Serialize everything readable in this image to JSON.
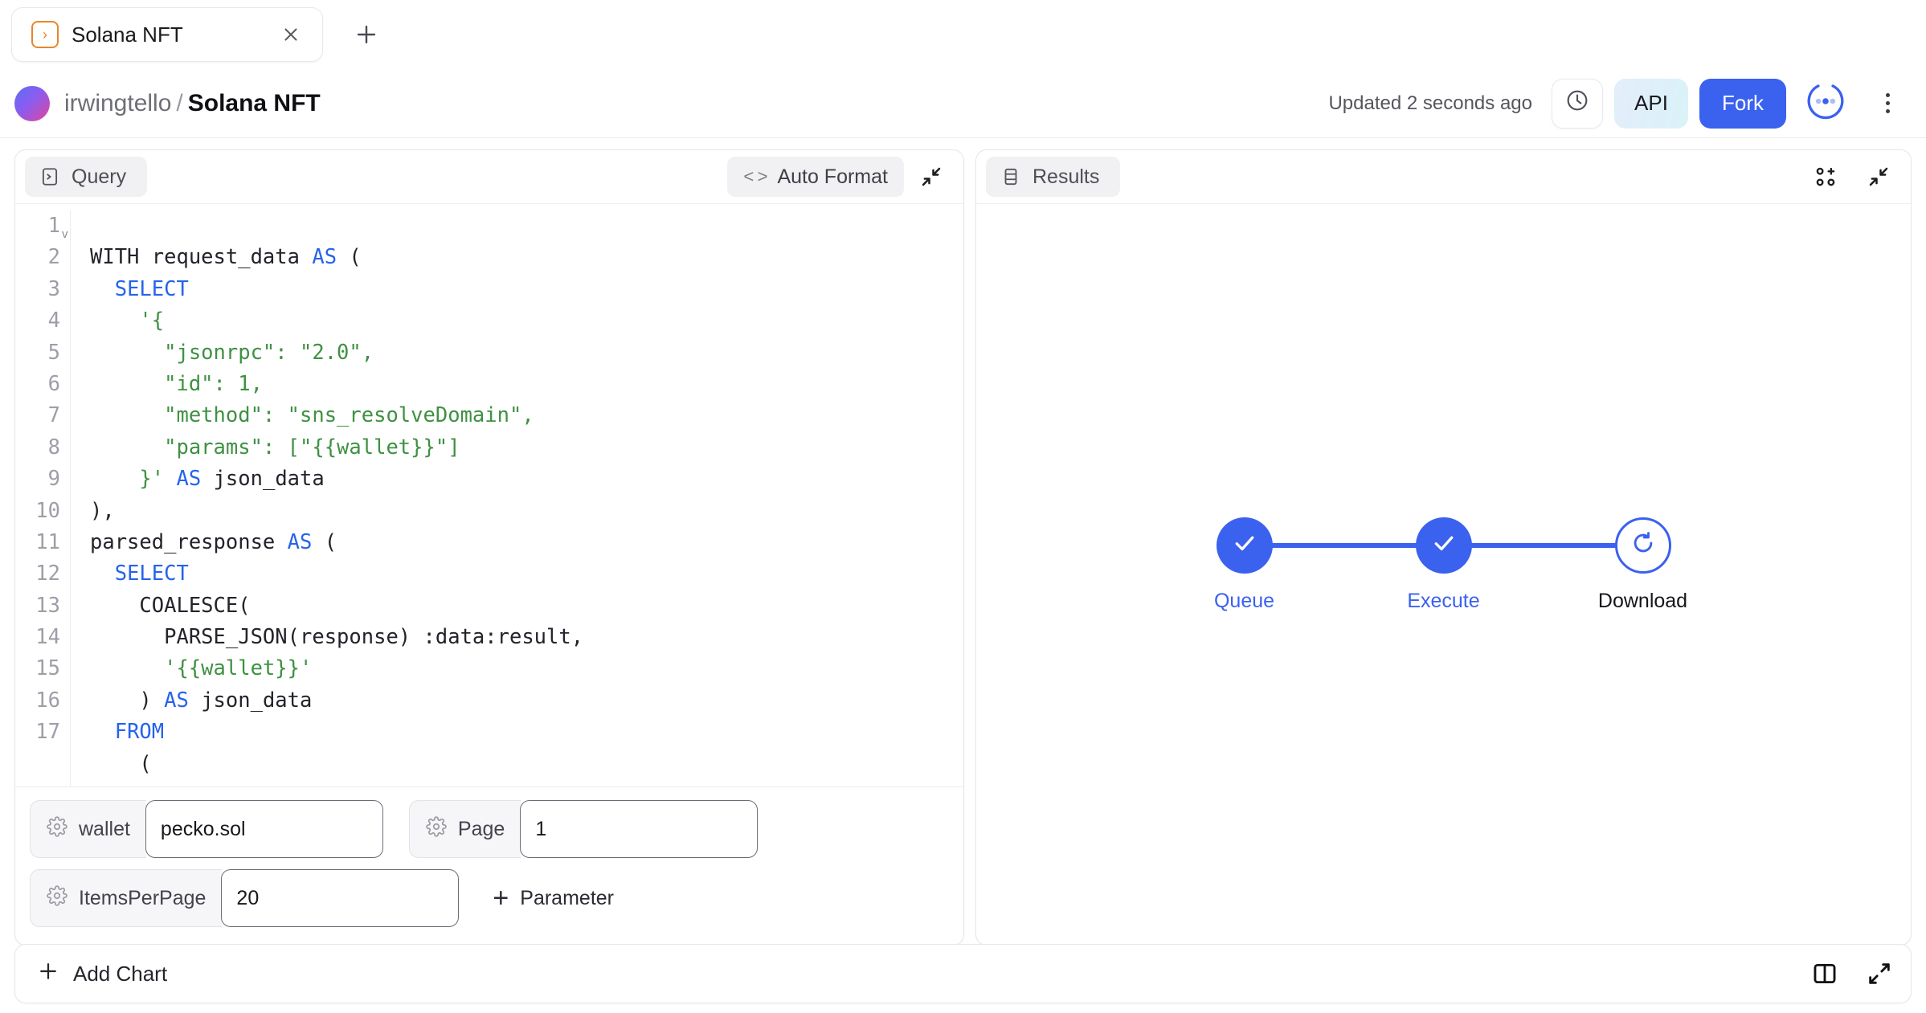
{
  "tabbar": {
    "tabs": [
      {
        "label": "Solana NFT",
        "icon": "query-chevron-icon",
        "close_icon": "close-icon"
      }
    ],
    "new_tab_icon": "plus-icon"
  },
  "header": {
    "avatar": "user-avatar",
    "owner": "irwingtello",
    "separator": "/",
    "query_name": "Solana NFT",
    "updated_text": "Updated 2 seconds ago",
    "history_icon": "clock-icon",
    "api_label": "API",
    "fork_label": "Fork",
    "run_status_icon": "loading-spinner-dots-icon",
    "more_icon": "kebab-menu-icon",
    "accent_blue": "#3b61ef",
    "api_gradient_from": "#e4edfb",
    "api_gradient_to": "#d9f2f8"
  },
  "query_panel": {
    "tab_label": "Query",
    "tab_icon": "terminal-icon",
    "auto_format_label": "Auto Format",
    "auto_format_icon": "code-brackets-icon",
    "collapse_icon": "collapse-inward-icon",
    "code_lines": [
      {
        "n": "1",
        "text": "WITH request_data AS ("
      },
      {
        "n": "2",
        "text": "  SELECT"
      },
      {
        "n": "3",
        "text": "    '{"
      },
      {
        "n": "4",
        "text": "      \"jsonrpc\": \"2.0\","
      },
      {
        "n": "5",
        "text": "      \"id\": 1,"
      },
      {
        "n": "6",
        "text": "      \"method\": \"sns_resolveDomain\","
      },
      {
        "n": "7",
        "text": "      \"params\": [\"{{wallet}}\"]"
      },
      {
        "n": "8",
        "text": "    }' AS json_data"
      },
      {
        "n": "9",
        "text": "),"
      },
      {
        "n": "10",
        "text": "parsed_response AS ("
      },
      {
        "n": "11",
        "text": "  SELECT"
      },
      {
        "n": "12",
        "text": "    COALESCE("
      },
      {
        "n": "13",
        "text": "      PARSE_JSON(response) :data:result,"
      },
      {
        "n": "14",
        "text": "      '{{wallet}}'"
      },
      {
        "n": "15",
        "text": "    ) AS json_data"
      },
      {
        "n": "16",
        "text": "  FROM"
      },
      {
        "n": "17",
        "text": "    ("
      }
    ],
    "fold_marker": "v",
    "parameters": [
      {
        "name": "wallet",
        "value": "pecko.sol",
        "icon": "gear-icon"
      },
      {
        "name": "Page",
        "value": "1",
        "icon": "gear-icon"
      },
      {
        "name": "ItemsPerPage",
        "value": "20",
        "icon": "gear-icon"
      }
    ],
    "add_parameter_label": "Parameter",
    "add_parameter_icon": "plus-icon"
  },
  "results_panel": {
    "tab_label": "Results",
    "tab_icon": "table-icon",
    "add_visualization_icon": "grid-plus-icon",
    "collapse_icon": "collapse-inward-icon",
    "stepper": [
      {
        "label": "Queue",
        "state": "done",
        "icon": "check-icon"
      },
      {
        "label": "Execute",
        "state": "done",
        "icon": "check-icon"
      },
      {
        "label": "Download",
        "state": "active",
        "icon": "refresh-spinner-icon"
      }
    ]
  },
  "bottombar": {
    "add_chart_label": "Add Chart",
    "add_chart_icon": "plus-icon",
    "split_layout_icon": "split-pane-icon",
    "expand_icon": "expand-diagonal-icon"
  }
}
